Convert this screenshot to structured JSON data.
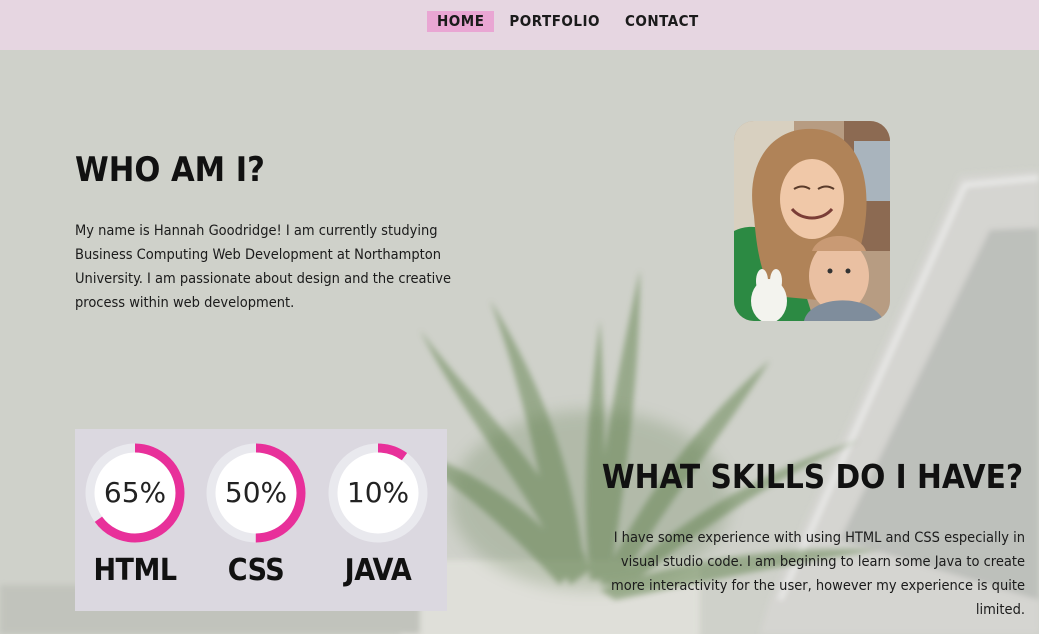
{
  "nav": {
    "items": [
      {
        "label": "HOME",
        "active": true
      },
      {
        "label": "PORTFOLIO",
        "active": false
      },
      {
        "label": "CONTACT",
        "active": false
      }
    ]
  },
  "about": {
    "heading": "WHO AM I?",
    "text": "My name is Hannah Goodridge! I am currently studying Business Computing Web Development at Northampton University. I am passionate about design and the creative process within web development."
  },
  "skills": {
    "heading": "WHAT SKILLS DO I HAVE?",
    "text": "I have some experience with using HTML and CSS especially in visual studio code. I am begining to learn some Java to create more interactivity for the user, however my experience is quite limited.",
    "items": [
      {
        "name": "HTML",
        "percent": 65,
        "percent_label": "65%"
      },
      {
        "name": "CSS",
        "percent": 50,
        "percent_label": "50%"
      },
      {
        "name": "JAVA",
        "percent": 10,
        "percent_label": "10%"
      }
    ]
  },
  "colors": {
    "nav_bg": "#e6d6e1",
    "nav_active": "#e9a6d3",
    "accent": "#e8309a",
    "ring_track": "#e9e9ee",
    "skills_panel_bg": "#dbd8e0"
  },
  "icons": {
    "profile_photo": "profile-photo"
  }
}
